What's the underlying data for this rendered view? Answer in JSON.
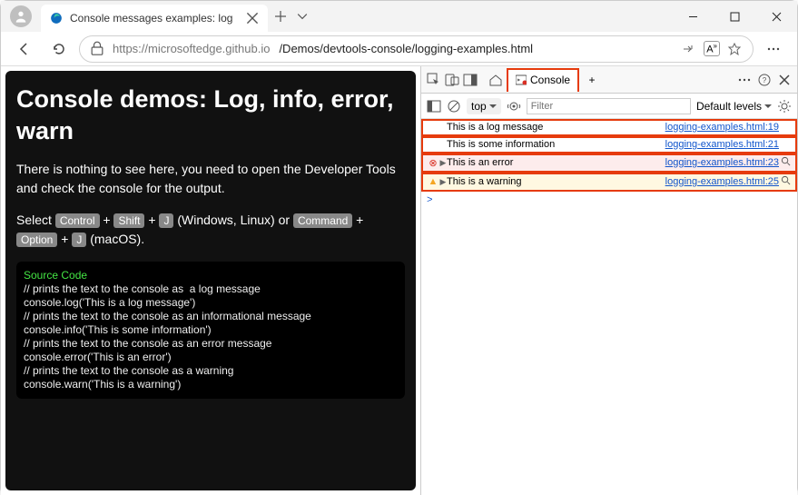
{
  "browser": {
    "tab_title": "Console messages examples: log",
    "url_prefix": "https://microsoftedge.github.io",
    "url_path": "/Demos/devtools-console/logging-examples.html"
  },
  "page": {
    "heading": "Console demos: Log, info, error, warn",
    "intro": "There is nothing to see here, you need to open the Developer Tools and check the console for the output.",
    "shortcut_prefix": "Select ",
    "kbd_ctrl": "Control",
    "plus1": " + ",
    "kbd_shift": "Shift",
    "plus2": " + ",
    "kbd_j": "J",
    "shortcut_mid": " (Windows, Linux) or ",
    "kbd_cmd": "Command",
    "plus3": " + ",
    "kbd_opt": "Option",
    "plus4": " + ",
    "kbd_j2": "J",
    "shortcut_suffix": " (macOS).",
    "code_title": "Source Code",
    "code_body": "// prints the text to the console as  a log message\nconsole.log('This is a log message')\n// prints the text to the console as an informational message\nconsole.info('This is some information')\n// prints the text to the console as an error message\nconsole.error('This is an error')\n// prints the text to the console as a warning\nconsole.warn('This is a warning')"
  },
  "devtools": {
    "tab_console": "Console",
    "plus_tab": "+",
    "context": "top",
    "filter_placeholder": "Filter",
    "levels": "Default levels",
    "rows": [
      {
        "msg": "This is a log message",
        "src": "logging-examples.html:19",
        "cls": "",
        "ico": "",
        "hl": true
      },
      {
        "msg": "This is some information",
        "src": "logging-examples.html:21",
        "cls": "",
        "ico": "",
        "hl": true
      },
      {
        "msg": "This is an error",
        "src": "logging-examples.html:23",
        "cls": "err",
        "ico": "err-icon",
        "hl": true
      },
      {
        "msg": "This is a warning",
        "src": "logging-examples.html:25",
        "cls": "warn",
        "ico": "warn-icon",
        "hl": true
      }
    ],
    "prompt": ">"
  }
}
